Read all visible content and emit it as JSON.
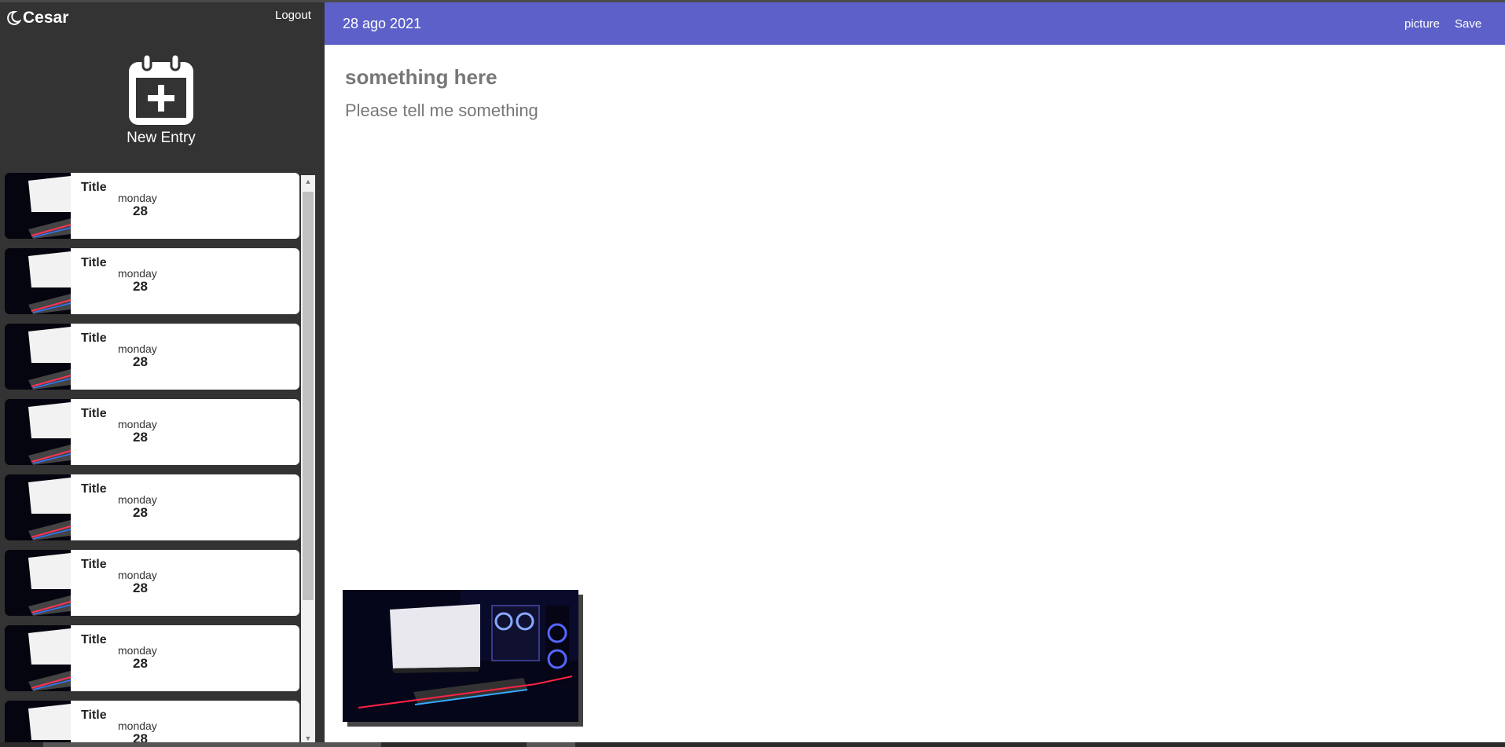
{
  "app": {
    "user_name": "Cesar",
    "logout_label": "Logout"
  },
  "sidebar": {
    "new_entry_label": "New Entry",
    "entries": [
      {
        "title": "Title",
        "weekday": "monday",
        "day": "28"
      },
      {
        "title": "Title",
        "weekday": "monday",
        "day": "28"
      },
      {
        "title": "Title",
        "weekday": "monday",
        "day": "28"
      },
      {
        "title": "Title",
        "weekday": "monday",
        "day": "28"
      },
      {
        "title": "Title",
        "weekday": "monday",
        "day": "28"
      },
      {
        "title": "Title",
        "weekday": "monday",
        "day": "28"
      },
      {
        "title": "Title",
        "weekday": "monday",
        "day": "28"
      },
      {
        "title": "Title",
        "weekday": "monday",
        "day": "28"
      }
    ]
  },
  "header": {
    "date": "28 ago 2021",
    "picture_label": "picture",
    "save_label": "Save"
  },
  "entry": {
    "title": "something here",
    "body": "Please tell me something"
  },
  "colors": {
    "header_bg": "#5c60c8",
    "sidebar_bg": "#333333",
    "text_muted": "#777777"
  },
  "icons": {
    "brand": "moon-icon",
    "new_entry": "calendar-plus-icon"
  }
}
